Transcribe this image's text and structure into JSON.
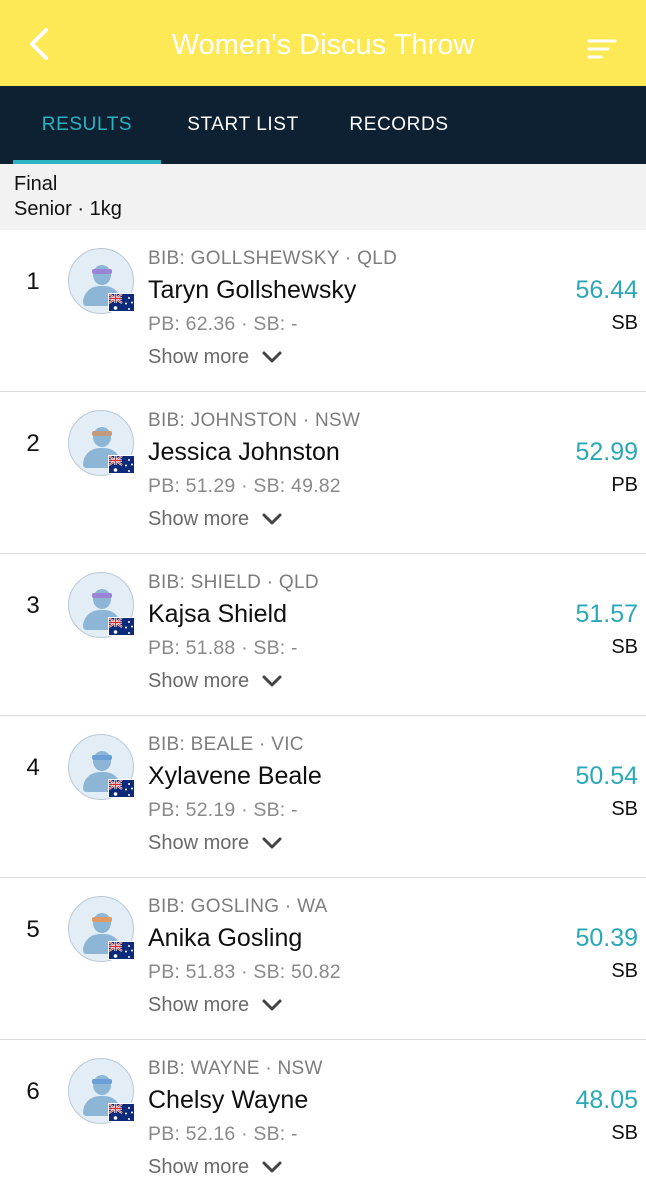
{
  "header": {
    "title": "Women's Discus Throw",
    "back_icon": "chevron-left-icon",
    "sort_icon": "sort-lines-icon",
    "bg_color": "#fde855"
  },
  "tabs": [
    {
      "label": "RESULTS",
      "active": true
    },
    {
      "label": "START LIST",
      "active": false
    },
    {
      "label": "RECORDS",
      "active": false
    }
  ],
  "event": {
    "round": "Final",
    "category": "Senior · 1kg"
  },
  "show_more_label": "Show more",
  "results": [
    {
      "rank": "1",
      "bib": "BIB: GOLLSHEWSKY · QLD",
      "name": "Taryn Gollshewsky",
      "pb_sb": "PB: 62.36 · SB: -",
      "mark": "56.44",
      "tag": "SB",
      "band_color": "#9b84d6"
    },
    {
      "rank": "2",
      "bib": "BIB: JOHNSTON · NSW",
      "name": "Jessica Johnston",
      "pb_sb": "PB: 51.29 · SB: 49.82",
      "mark": "52.99",
      "tag": "PB",
      "band_color": "#c49a7c"
    },
    {
      "rank": "3",
      "bib": "BIB: SHIELD · QLD",
      "name": "Kajsa Shield",
      "pb_sb": "PB: 51.88 · SB: -",
      "mark": "51.57",
      "tag": "SB",
      "band_color": "#9b84d6"
    },
    {
      "rank": "4",
      "bib": "BIB: BEALE · VIC",
      "name": "Xylavene Beale",
      "pb_sb": "PB: 52.19 · SB: -",
      "mark": "50.54",
      "tag": "SB",
      "band_color": "#6aa0d6"
    },
    {
      "rank": "5",
      "bib": "BIB: GOSLING · WA",
      "name": "Anika Gosling",
      "pb_sb": "PB: 51.83 · SB: 50.82",
      "mark": "50.39",
      "tag": "SB",
      "band_color": "#e09a64"
    },
    {
      "rank": "6",
      "bib": "BIB: WAYNE · NSW",
      "name": "Chelsy Wayne",
      "pb_sb": "PB: 52.16 · SB: -",
      "mark": "48.05",
      "tag": "SB",
      "band_color": "#6aa0d6"
    }
  ],
  "colors": {
    "accent": "#2aa8b8",
    "tabs_bg": "#0d2133"
  }
}
